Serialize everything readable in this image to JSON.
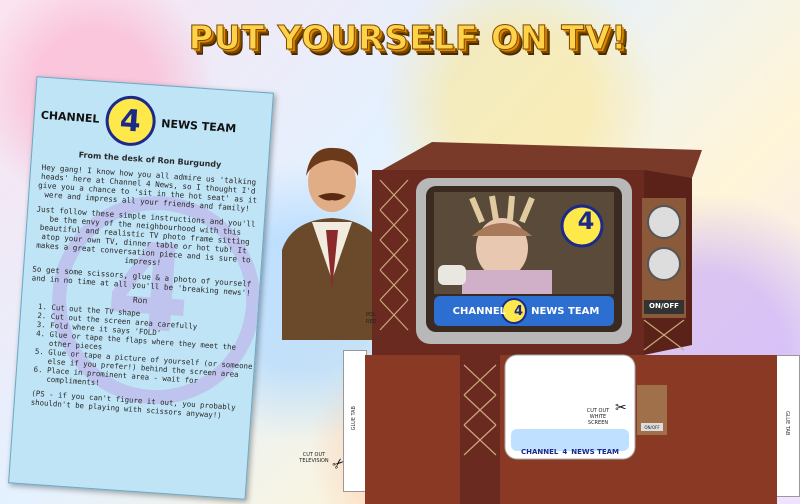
{
  "headline": "PUT YOURSELF ON TV!",
  "letter": {
    "logo_left": "CHANNEL",
    "logo_number": "4",
    "logo_right": "NEWS TEAM",
    "from": "From the desk of Ron Burgundy",
    "para1": "Hey gang! I know how you all admire us 'talking heads' here at Channel 4 News, so I thought I'd give you a chance to 'sit in the hot seat' as it were and impress all your friends and family!",
    "para2": "Just follow these simple instructions and you'll be the envy of the neighbourhood with this beautiful and realistic TV photo frame sitting atop your own TV, dinner table or hot tub! It makes a great conversation piece and is sure to impress!",
    "para3": "So get some scissors, glue & a photo of yourself and in no time at all you'll be 'breaking news'!",
    "signature": "Ron",
    "steps": [
      "Cut out the TV shape",
      "Cut out the screen area carefully",
      "Fold where it says 'FOLD'",
      "Glue or tape the flaps where they meet the other pieces",
      "Glue or tape a picture of yourself (or someone else if you prefer!) behind the screen area",
      "Place in prominent area - wait for compliments!"
    ],
    "ps": "(PS - if you can't figure it out, you probably shouldn't be playing with scissors anyway!)"
  },
  "tv": {
    "screen_logo_left": "CHANNEL",
    "screen_logo_number": "4",
    "screen_logo_right": "NEWS TEAM",
    "power_label": "ON/OFF"
  },
  "template": {
    "glue_tab_left": "GLUE TAB",
    "glue_tab_right": "GLUE TAB",
    "cut_out_white_screen": "CUT OUT WHITE SCREEN",
    "cut_out_television": "CUT OUT TELEVISION",
    "power_label": "ON/OFF",
    "logo_left": "CHANNEL",
    "logo_number": "4",
    "logo_right": "NEWS TEAM",
    "fold_partial": "POL",
    "red_partial": "RED"
  },
  "colors": {
    "headline_fill": "#ffd24a",
    "letter_bg": "#bfe4f5",
    "tv_wood": "#6b2a20",
    "logo_blue": "#1b2a8a",
    "logo_yellow": "#ffe94a"
  }
}
